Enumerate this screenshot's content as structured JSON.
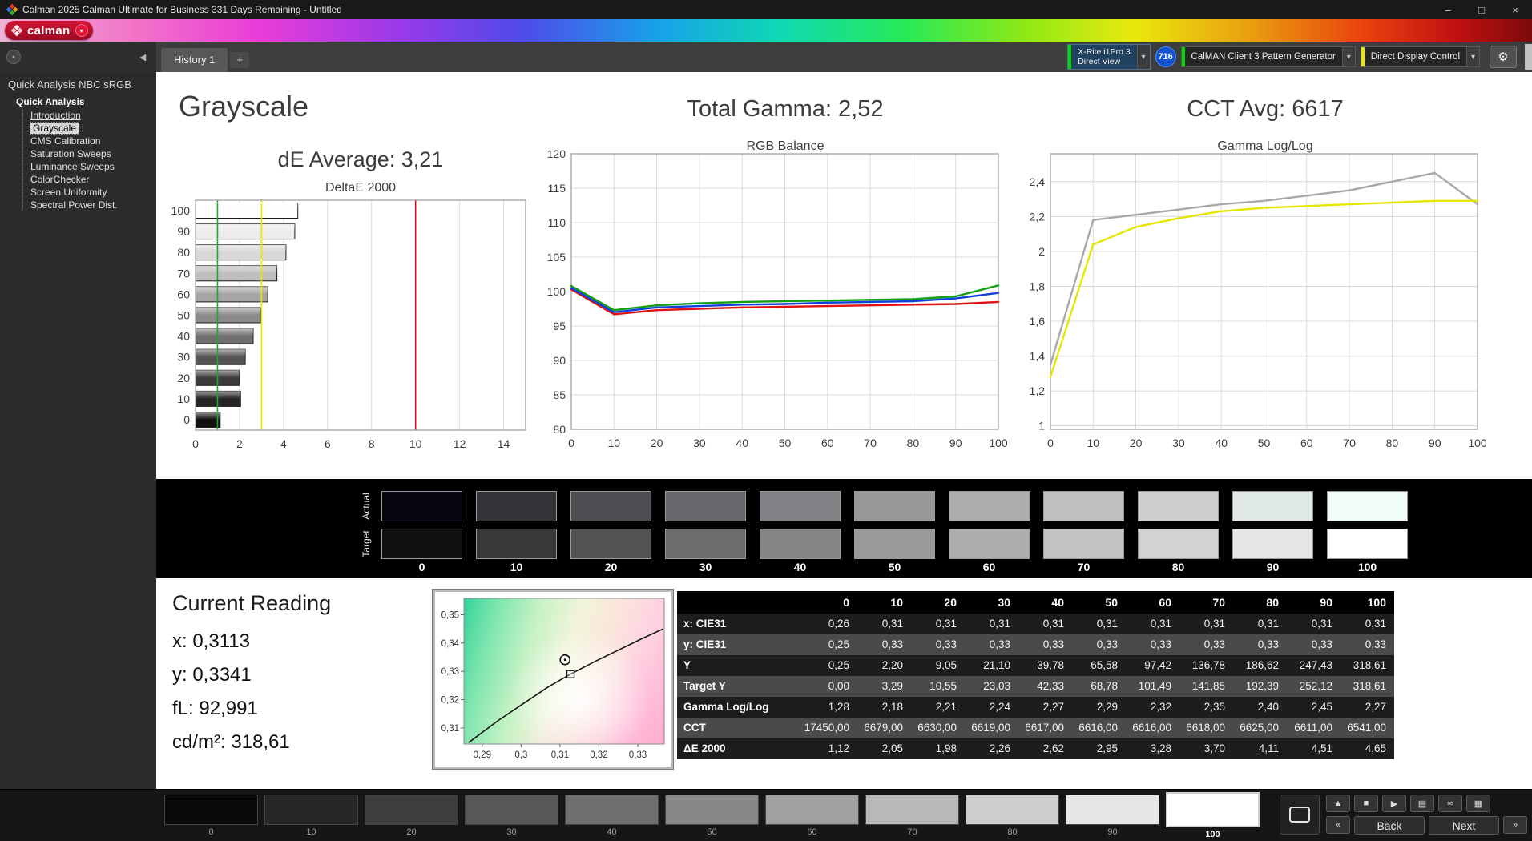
{
  "titlebar": {
    "title": "Calman 2025 Calman Ultimate for Business 331 Days Remaining  - Untitled"
  },
  "brand": {
    "logo": "calman"
  },
  "tabs": {
    "active": "History 1"
  },
  "icons": {
    "minimize": "–",
    "maximize": "□",
    "close": "×",
    "caret": "▾",
    "collapse": "◀",
    "add_tab": "+",
    "gear": "⚙",
    "up": "▲",
    "stop": "■",
    "play": "▶",
    "save": "▤",
    "loop": "∞",
    "screens": "▦",
    "prev": "«",
    "next": "»",
    "dot": "●"
  },
  "devices": {
    "meter_line1": "X-Rite i1Pro 3",
    "meter_line2": "Direct View",
    "meter_count": "716",
    "pattern_generator": "CalMAN Client 3 Pattern Generator",
    "display_control": "Direct Display Control"
  },
  "sidebar": {
    "workflow_title": "Quick Analysis NBC sRGB",
    "root": "Quick Analysis",
    "items": [
      "Introduction",
      "Grayscale",
      "CMS Calibration",
      "Saturation Sweeps",
      "Luminance Sweeps",
      "ColorChecker",
      "Screen Uniformity",
      "Spectral Power Dist."
    ],
    "selected": "Grayscale"
  },
  "headings": {
    "grayscale": "Grayscale",
    "de_average": "dE Average: 3,21",
    "total_gamma": "Total Gamma: 2,52",
    "cct_avg": "CCT Avg: 6617"
  },
  "chart_data": [
    {
      "type": "bar",
      "title": "DeltaE 2000",
      "orientation": "horizontal",
      "categories": [
        "100",
        "90",
        "80",
        "70",
        "60",
        "50",
        "40",
        "30",
        "20",
        "10",
        "0"
      ],
      "values": [
        4.65,
        4.51,
        4.11,
        3.7,
        3.28,
        2.95,
        2.62,
        2.26,
        1.98,
        2.05,
        1.12
      ],
      "xlim": [
        0,
        15
      ],
      "xticks": [
        0,
        2,
        4,
        6,
        8,
        10,
        12,
        14
      ],
      "reference_lines": [
        {
          "value": 1,
          "color": "#1faa1f"
        },
        {
          "value": 3,
          "color": "#e8e800"
        },
        {
          "value": 10,
          "color": "#e01010"
        }
      ],
      "bar_colors": [
        "#fdfdfd",
        "#ececec",
        "#d8d8d8",
        "#bfbfbf",
        "#a5a5a5",
        "#8a8a8a",
        "#6f6f6f",
        "#555555",
        "#3c3c3c",
        "#262626",
        "#101010"
      ],
      "grid": true
    },
    {
      "type": "line",
      "title": "RGB Balance",
      "x": [
        0,
        10,
        20,
        30,
        40,
        50,
        60,
        70,
        80,
        90,
        100
      ],
      "ylim": [
        80,
        120
      ],
      "yticks": [
        80,
        85,
        90,
        95,
        100,
        105,
        110,
        115,
        120
      ],
      "xticks": [
        0,
        10,
        20,
        30,
        40,
        50,
        60,
        70,
        80,
        90,
        100
      ],
      "series": [
        {
          "name": "Red",
          "color": "#e01212",
          "values": [
            100.3,
            96.7,
            97.3,
            97.5,
            97.7,
            97.8,
            97.9,
            98.0,
            98.1,
            98.2,
            98.5
          ]
        },
        {
          "name": "Green",
          "color": "#10a010",
          "values": [
            100.8,
            97.3,
            98.0,
            98.3,
            98.5,
            98.6,
            98.7,
            98.8,
            98.9,
            99.3,
            100.9
          ]
        },
        {
          "name": "Blue",
          "color": "#1040e0",
          "values": [
            100.5,
            97.0,
            97.7,
            97.9,
            98.1,
            98.2,
            98.4,
            98.5,
            98.6,
            99.0,
            99.8
          ]
        }
      ],
      "grid": true
    },
    {
      "type": "line",
      "title": "Gamma Log/Log",
      "x": [
        0,
        10,
        20,
        30,
        40,
        50,
        60,
        70,
        80,
        90,
        100
      ],
      "ylim": [
        0.98,
        2.56
      ],
      "yticks": [
        1,
        1.2,
        1.4,
        1.6,
        1.8,
        2,
        2.2,
        2.4
      ],
      "ytick_labels": [
        "1",
        "1,2",
        "1,4",
        "1,6",
        "1,8",
        "2",
        "2,2",
        "2,4"
      ],
      "xticks": [
        0,
        10,
        20,
        30,
        40,
        50,
        60,
        70,
        80,
        90,
        100
      ],
      "series": [
        {
          "name": "Point Gamma",
          "color": "#a8a8a8",
          "values": [
            1.35,
            2.18,
            2.21,
            2.24,
            2.27,
            2.29,
            2.32,
            2.35,
            2.4,
            2.45,
            2.27
          ]
        },
        {
          "name": "Gamma",
          "color": "#e6e600",
          "values": [
            1.28,
            2.04,
            2.14,
            2.19,
            2.23,
            2.25,
            2.26,
            2.27,
            2.28,
            2.29,
            2.29
          ]
        }
      ],
      "grid": true
    },
    {
      "type": "scatter",
      "title": "CIE 1931 xy",
      "xlim": [
        0.2853,
        0.3368
      ],
      "ylim": [
        0.3043,
        0.3558
      ],
      "xticks": [
        0.29,
        0.3,
        0.31,
        0.32,
        0.33
      ],
      "xtick_labels": [
        "0,29",
        "0,3",
        "0,31",
        "0,32",
        "0,33"
      ],
      "yticks": [
        0.31,
        0.32,
        0.33,
        0.34,
        0.35
      ],
      "ytick_labels": [
        "0,31",
        "0,32",
        "0,33",
        "0,34",
        "0,35"
      ],
      "locus": [
        [
          0.2865,
          0.3048
        ],
        [
          0.294,
          0.3125
        ],
        [
          0.301,
          0.319
        ],
        [
          0.307,
          0.3245
        ],
        [
          0.3127,
          0.329
        ],
        [
          0.319,
          0.3335
        ],
        [
          0.325,
          0.3375
        ],
        [
          0.331,
          0.3415
        ],
        [
          0.3365,
          0.345
        ]
      ],
      "measured_point": {
        "x": 0.3113,
        "y": 0.3341
      },
      "target_point": {
        "x": 0.3127,
        "y": 0.329
      }
    }
  ],
  "swatch_strip": {
    "row_labels": [
      "Actual",
      "Target"
    ],
    "columns": [
      "0",
      "10",
      "20",
      "30",
      "40",
      "50",
      "60",
      "70",
      "80",
      "90",
      "100"
    ],
    "actual_colors": [
      "#05060f",
      "#333338",
      "#4e4e52",
      "#68686c",
      "#828286",
      "#98989b",
      "#adadaf",
      "#c0c0c2",
      "#cfcfd1",
      "#e2eae6",
      "#f2fcf6"
    ],
    "target_colors": [
      "#101012",
      "#38383a",
      "#525254",
      "#6c6c6e",
      "#858587",
      "#9a9a9c",
      "#aeaeb0",
      "#c2c2c4",
      "#d2d2d4",
      "#e6e6e8",
      "#ffffff"
    ]
  },
  "current_reading": {
    "title": "Current Reading",
    "x": "x: 0,3113",
    "y": "y: 0,3341",
    "fl": "fL: 92,991",
    "cd": "cd/m²: 318,61"
  },
  "results_table": {
    "columns": [
      "0",
      "10",
      "20",
      "30",
      "40",
      "50",
      "60",
      "70",
      "80",
      "90",
      "100"
    ],
    "rows": [
      {
        "label": "x: CIE31",
        "values": [
          "0,26",
          "0,31",
          "0,31",
          "0,31",
          "0,31",
          "0,31",
          "0,31",
          "0,31",
          "0,31",
          "0,31",
          "0,31"
        ]
      },
      {
        "label": "y: CIE31",
        "values": [
          "0,25",
          "0,33",
          "0,33",
          "0,33",
          "0,33",
          "0,33",
          "0,33",
          "0,33",
          "0,33",
          "0,33",
          "0,33"
        ]
      },
      {
        "label": "Y",
        "values": [
          "0,25",
          "2,20",
          "9,05",
          "21,10",
          "39,78",
          "65,58",
          "97,42",
          "136,78",
          "186,62",
          "247,43",
          "318,61"
        ]
      },
      {
        "label": "Target Y",
        "values": [
          "0,00",
          "3,29",
          "10,55",
          "23,03",
          "42,33",
          "68,78",
          "101,49",
          "141,85",
          "192,39",
          "252,12",
          "318,61"
        ]
      },
      {
        "label": "Gamma Log/Log",
        "values": [
          "1,28",
          "2,18",
          "2,21",
          "2,24",
          "2,27",
          "2,29",
          "2,32",
          "2,35",
          "2,40",
          "2,45",
          "2,27"
        ]
      },
      {
        "label": "CCT",
        "values": [
          "17450,00",
          "6679,00",
          "6630,00",
          "6619,00",
          "6617,00",
          "6616,00",
          "6616,00",
          "6618,00",
          "6625,00",
          "6611,00",
          "6541,00"
        ]
      },
      {
        "label": "ΔE 2000",
        "values": [
          "1,12",
          "2,05",
          "1,98",
          "2,26",
          "2,62",
          "2,95",
          "3,28",
          "3,70",
          "4,11",
          "4,51",
          "4,65"
        ]
      }
    ]
  },
  "pattern_buttons": {
    "labels": [
      "0",
      "10",
      "20",
      "30",
      "40",
      "50",
      "60",
      "70",
      "80",
      "90",
      "100"
    ],
    "colors": [
      "#0a0a0a",
      "#262626",
      "#3e3e3e",
      "#575757",
      "#707070",
      "#888888",
      "#a0a0a0",
      "#b8b8b8",
      "#cecece",
      "#e6e6e6",
      "#ffffff"
    ],
    "selected_index": 10
  },
  "transport": {
    "back": "Back",
    "next": "Next"
  },
  "colors": {
    "accent_green": "#00d800",
    "accent_yellow": "#e8e800",
    "badge_blue": "#1353cf",
    "brand_red": "#c00f2d"
  }
}
